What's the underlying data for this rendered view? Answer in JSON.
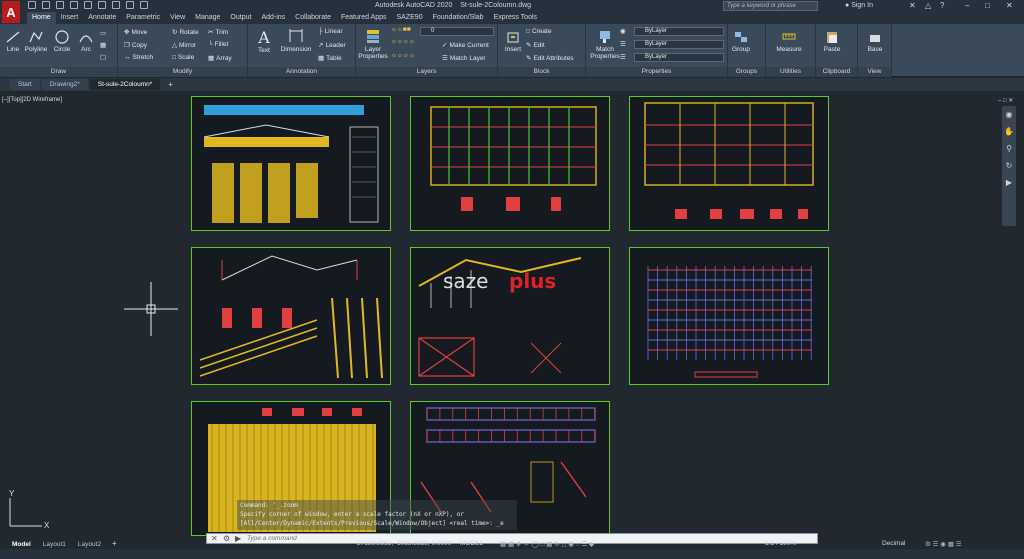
{
  "titlebar": {
    "app_title": "Autodesk AutoCAD 2020",
    "file_name": "St-sule-2Coloumn.dwg",
    "search_placeholder": "Type a keyword or phrase",
    "signin": "Sign In"
  },
  "ribbon_tabs": [
    "Home",
    "Insert",
    "Annotate",
    "Parametric",
    "View",
    "Manage",
    "Output",
    "Add-ins",
    "Collaborate",
    "Featured Apps",
    "SAZE90",
    "Foundation/Slab",
    "Express Tools"
  ],
  "ribbon": {
    "draw": {
      "title": "Draw",
      "line": "Line",
      "polyline": "Polyline",
      "circle": "Circle",
      "arc": "Arc"
    },
    "modify": {
      "title": "Modify",
      "move": "Move",
      "rotate": "Rotate",
      "trim": "Trim",
      "copy": "Copy",
      "mirror": "Mirror",
      "fillet": "Fillet",
      "stretch": "Stretch",
      "scale": "Scale",
      "array": "Array"
    },
    "annotation": {
      "title": "Annotation",
      "text": "Text",
      "dimension": "Dimension",
      "linear": "Linear",
      "leader": "Leader",
      "table": "Table"
    },
    "layers": {
      "title": "Layers",
      "layer_properties_1": "Layer",
      "layer_properties_2": "Properties",
      "current_layer": "0",
      "make_current": "Make Current",
      "match_layer": "Match Layer"
    },
    "block": {
      "title": "Block",
      "insert": "Insert",
      "create": "Create",
      "edit": "Edit",
      "edit_attributes": "Edit Attributes"
    },
    "properties": {
      "title": "Properties",
      "match_1": "Match",
      "match_2": "Properties",
      "color": "ByLayer",
      "linetype": "ByLayer",
      "lineweight": "ByLayer"
    },
    "groups": {
      "title": "Groups",
      "group": "Group"
    },
    "utilities": {
      "title": "Utilities",
      "measure": "Measure"
    },
    "clipboard": {
      "title": "Clipboard",
      "paste": "Paste"
    },
    "view": {
      "title": "View",
      "base": "Base"
    }
  },
  "doc_tabs": [
    "Start",
    "Drawing2*",
    "St-sule-2Coloumn*"
  ],
  "viewport_label": "[–][Top][2D Wireframe]",
  "sheets": {
    "watermark_a": "saze",
    "watermark_b": "plus"
  },
  "command": {
    "history": [
      "Command: '_.zoom",
      "Specify corner of window, enter a scale factor (nX or nXP), or",
      "[All/Center/Dynamic/Extents/Previous/Scale/Window/Object] <real time>: _e"
    ],
    "input_placeholder": "Type a command"
  },
  "layout_tabs": [
    "Model",
    "Layout1",
    "Layout2"
  ],
  "status": {
    "coords": "27189.8958, -5083.8933, 0.0000",
    "mode": "MODEL",
    "scale": "1:1 / 100%",
    "units": "Decimal"
  },
  "colors": {
    "sheet_border": "#5cc82a",
    "canvas": "#212830",
    "ribbon": "#3b4a5a"
  }
}
